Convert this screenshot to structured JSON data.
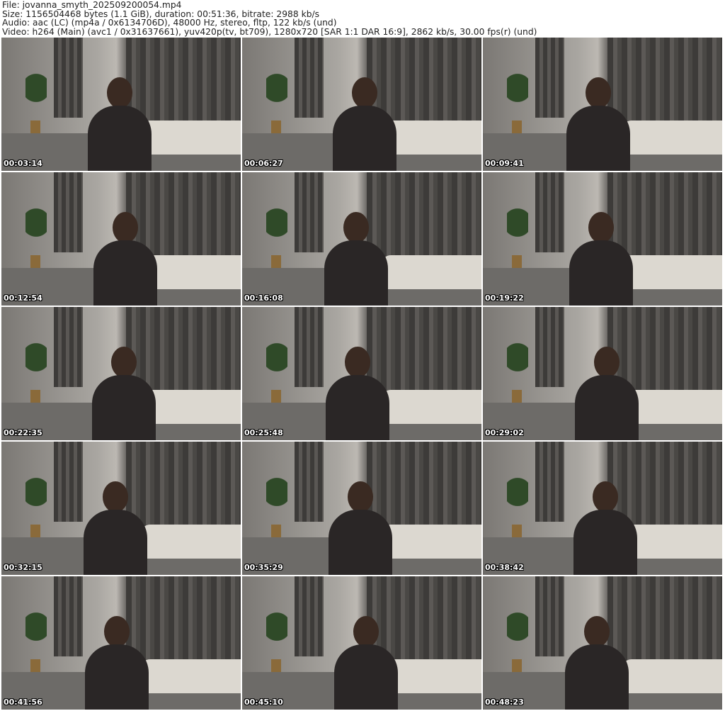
{
  "header": {
    "file": "File: jovanna_smyth_202509200054.mp4",
    "size": "Size: 1156504468 bytes (1.1 GiB), duration: 00:51:36, bitrate: 2988 kb/s",
    "audio": "Audio: aac (LC) (mp4a / 0x6134706D), 48000 Hz, stereo, fltp, 122 kb/s (und)",
    "video": "Video: h264 (Main) (avc1 / 0x31637661), yuv420p(tv, bt709), 1280x720 [SAR 1:1 DAR 16:9], 2862 kb/s, 30.00 fps(r) (und)"
  },
  "thumbnails": [
    {
      "timestamp": "00:03:14"
    },
    {
      "timestamp": "00:06:27"
    },
    {
      "timestamp": "00:09:41"
    },
    {
      "timestamp": "00:12:54"
    },
    {
      "timestamp": "00:16:08"
    },
    {
      "timestamp": "00:19:22"
    },
    {
      "timestamp": "00:22:35"
    },
    {
      "timestamp": "00:25:48"
    },
    {
      "timestamp": "00:29:02"
    },
    {
      "timestamp": "00:32:15"
    },
    {
      "timestamp": "00:35:29"
    },
    {
      "timestamp": "00:38:42"
    },
    {
      "timestamp": "00:41:56"
    },
    {
      "timestamp": "00:45:10"
    },
    {
      "timestamp": "00:48:23"
    }
  ]
}
